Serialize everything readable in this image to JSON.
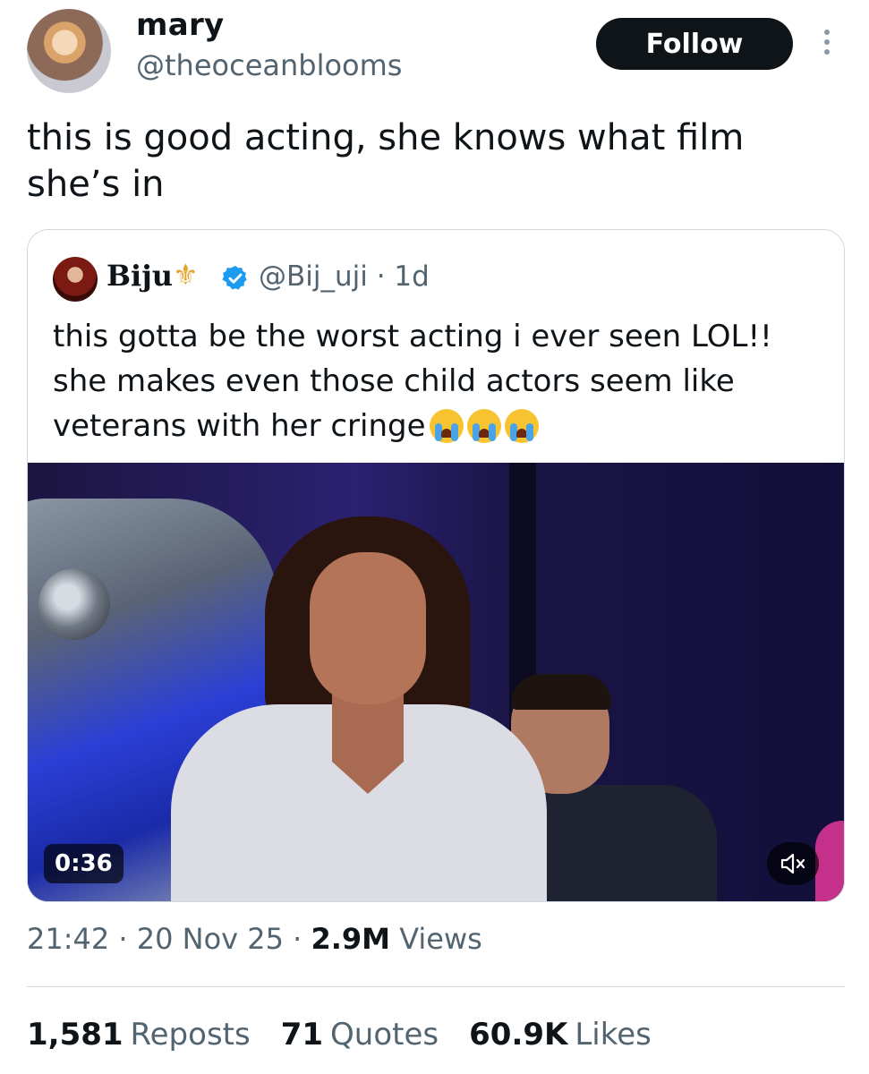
{
  "author": {
    "display_name": "mary",
    "handle": "@theoceanblooms",
    "follow_label": "Follow"
  },
  "tweet": {
    "line1": "this is good acting, she knows what film",
    "line2": "she’s in"
  },
  "quoted": {
    "display_name": "Biju",
    "handle_time": "@Bij_uji · 1d",
    "line1": "this gotta be the worst acting i ever seen LOL!!",
    "line2": "she makes even those child actors seem like",
    "line3": "veterans with her cringe",
    "emoji_icon": "loudly-crying-face-icon",
    "verified_color": "#1d9bf0",
    "fleur_color": "#e3a52e",
    "video": {
      "duration": "0:36"
    }
  },
  "meta": {
    "time": "21:42",
    "date": "20 Nov 25",
    "views_count": "2.9M",
    "views_label": "Views"
  },
  "stats": {
    "reposts_count": "1,581",
    "reposts_label": "Reposts",
    "quotes_count": "71",
    "quotes_label": "Quotes",
    "likes_count": "60.9K",
    "likes_label": "Likes"
  }
}
